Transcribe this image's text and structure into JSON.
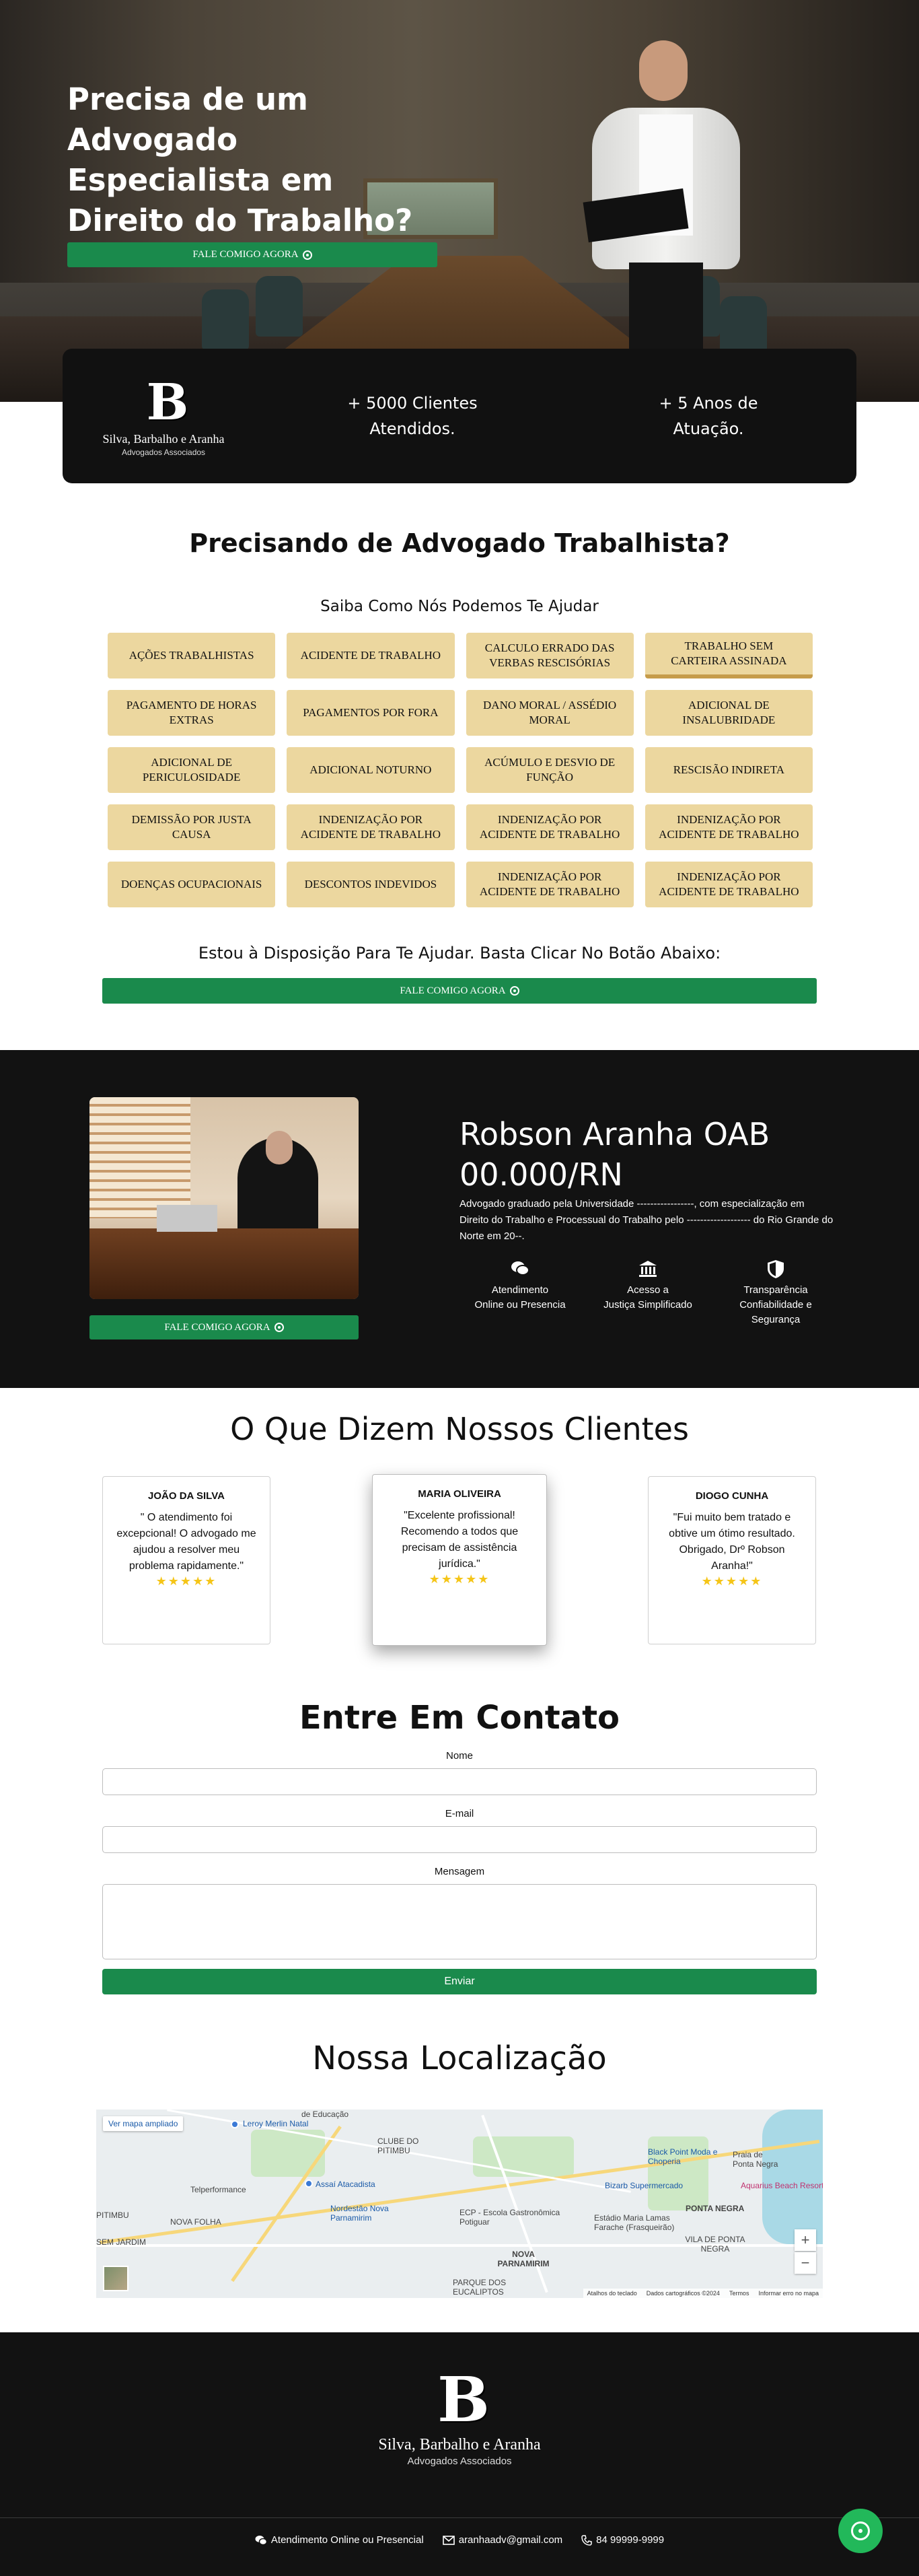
{
  "hero": {
    "headline": "Precisa de um Advogado Especialista em Direito do Trabalho?",
    "cta_label": "FALE COMIGO AGORA"
  },
  "firm": {
    "name": "Silva, Barbalho e Aranha",
    "subtitle": "Advogados Associados",
    "monogram": "B"
  },
  "stats": [
    {
      "line1": "+ 5000 Clientes",
      "line2": "Atendidos."
    },
    {
      "line1": "+ 5 Anos de",
      "line2": "Atuação."
    }
  ],
  "services_section": {
    "title": "Precisando de Advogado Trabalhista?",
    "subtitle": "Saiba Como Nós Podemos Te Ajudar",
    "items": [
      "AÇÕES TRABALHISTAS",
      "ACIDENTE DE TRABALHO",
      "CALCULO ERRADO DAS VERBAS RESCISÓRIAS",
      "TRABALHO SEM CARTEIRA ASSINADA",
      "PAGAMENTO DE HORAS EXTRAS",
      "PAGAMENTOS POR FORA",
      "DANO MORAL / ASSÉDIO MORAL",
      "ADICIONAL DE INSALUBRIDADE",
      "ADICIONAL DE PERICULOSIDADE",
      "ADICIONAL NOTURNO",
      "ACÚMULO E DESVIO DE FUNÇÃO",
      "RESCISÃO INDIRETA",
      "DEMISSÃO POR JUSTA CAUSA",
      "INDENIZAÇÃO POR ACIDENTE DE TRABALHO",
      "INDENIZAÇÃO POR ACIDENTE DE TRABALHO",
      "INDENIZAÇÃO POR ACIDENTE DE TRABALHO",
      "DOENÇAS OCUPACIONAIS",
      "DESCONTOS INDEVIDOS",
      "INDENIZAÇÃO POR ACIDENTE DE TRABALHO",
      "INDENIZAÇÃO POR ACIDENTE DE TRABALHO"
    ],
    "closing": "Estou à Disposição Para Te Ajudar. Basta Clicar No Botão Abaixo:",
    "cta_label": "FALE COMIGO AGORA"
  },
  "about": {
    "name": "Robson Aranha OAB 00.000/RN",
    "bio": "Advogado graduado pela Universidade -----------------, com especialização em Direito do Trabalho e Processual do Trabalho pelo ------------------- do Rio Grande do Norte em 20--.",
    "cta_label": "FALE COMIGO AGORA",
    "features": [
      {
        "icon": "chat-icon",
        "line1": "Atendimento",
        "line2": "Online ou Presencia"
      },
      {
        "icon": "courthouse-icon",
        "line1": "Acesso a",
        "line2": "Justiça Simplificado"
      },
      {
        "icon": "shield-icon",
        "line1": "Transparência",
        "line2": "Confiabilidade e Segurança"
      }
    ]
  },
  "testimonials": {
    "title": "O Que Dizem Nossos Clientes",
    "items": [
      {
        "name": "JOÃO DA SILVA",
        "quote": "\" O atendimento foi excepcional! O advogado me ajudou a resolver meu problema rapidamente.\"",
        "stars": "★★★★★"
      },
      {
        "name": "MARIA OLIVEIRA",
        "quote": "\"Excelente profissional! Recomendo a todos que precisam de assistência jurídica.\"",
        "stars": "★★★★★"
      },
      {
        "name": "DIOGO CUNHA",
        "quote": "\"Fui muito bem tratado e obtive um ótimo resultado. Obrigado, Drº Robson Aranha!\"",
        "stars": "★★★★★"
      }
    ]
  },
  "contact": {
    "title": "Entre Em Contato",
    "name_label": "Nome",
    "email_label": "E-mail",
    "message_label": "Mensagem",
    "submit_label": "Enviar"
  },
  "location": {
    "title": "Nossa Localização",
    "enlarge_label": "Ver mapa ampliado",
    "labels": [
      "de Educação",
      "Leroy Merlin Natal",
      "CLUBE DO PITIMBU",
      "Telperformance",
      "Assaí Atacadista",
      "Nordestão Nova Parnamirim",
      "ECP - Escola Gastronômica Potiguar",
      "NOVA PARNAMIRIM",
      "Black Point Moda e Choperia",
      "Bizarb Supermercado",
      "Aquarius Beach Resort",
      "PONTA NEGRA",
      "Estádio Maria Lamas Farache (Frasqueirão)",
      "VILA DE PONTA NEGRA",
      "PARQUE DOS EUCALIPTOS",
      "Praia de Ponta Negra",
      "NOVA FOLHA",
      "PITIMBU",
      "SEM JARDIM"
    ],
    "zoom_in": "+",
    "zoom_out": "−",
    "attribution": [
      "Atalhos do teclado",
      "Dados cartográficos ©2024",
      "Termos",
      "Informar erro no mapa"
    ]
  },
  "footer": {
    "contacts": [
      {
        "icon": "chat-icon",
        "text": "Atendimento Online ou Presencial"
      },
      {
        "icon": "mail-icon",
        "text": "aranhaadv@gmail.com"
      },
      {
        "icon": "phone-icon",
        "text": "84 99999-9999"
      }
    ]
  },
  "colors": {
    "accent_green": "#1a8a4c",
    "service_gold": "#ecd79f",
    "dark_bg": "#121212",
    "star": "#f5c518"
  }
}
